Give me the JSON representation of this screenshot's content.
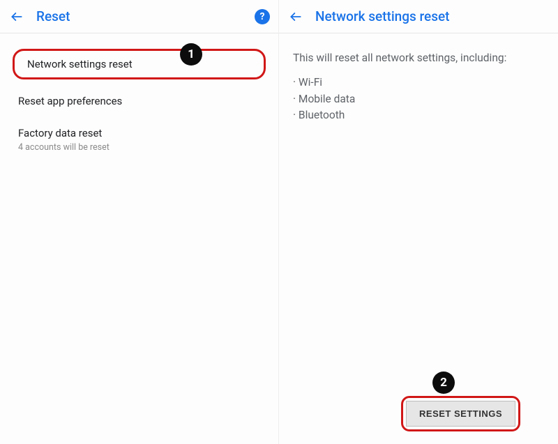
{
  "left": {
    "title": "Reset",
    "help_symbol": "?",
    "items": [
      {
        "label": "Network settings reset",
        "sub": ""
      },
      {
        "label": "Reset app preferences",
        "sub": ""
      },
      {
        "label": "Factory data reset",
        "sub": "4 accounts will be reset"
      }
    ],
    "annotation_number": "1"
  },
  "right": {
    "title": "Network settings reset",
    "description": "This will reset all network settings, including:",
    "bullets": [
      "Wi-Fi",
      "Mobile data",
      "Bluetooth"
    ],
    "button_label": "RESET SETTINGS",
    "annotation_number": "2"
  }
}
